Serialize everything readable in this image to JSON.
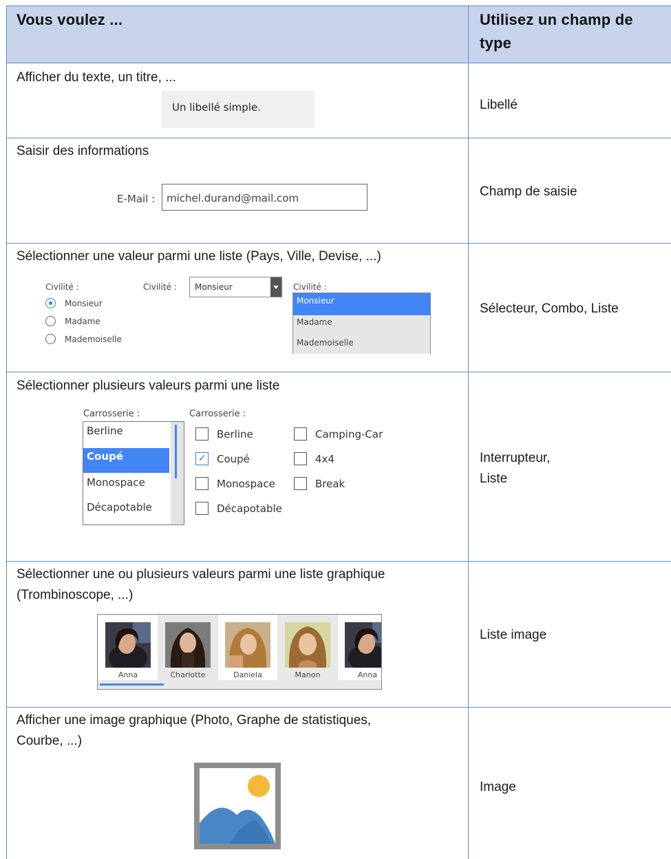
{
  "header": {
    "col1": "Vous voulez ...",
    "col2_line1": "Utilisez un champ de",
    "col2_line2": "type"
  },
  "rows": [
    {
      "description": "Afficher du texte, un titre, ...",
      "type": "Libellé",
      "example": {
        "label_text": "Un libellé simple."
      }
    },
    {
      "description": "Saisir des informations",
      "type": "Champ de saisie",
      "example": {
        "field_label": "E-Mail :",
        "field_value": "michel.durand@mail.com"
      }
    },
    {
      "description": "Sélectionner une valeur parmi une liste (Pays, Ville, Devise, ...)",
      "type": "Sélecteur, Combo, Liste",
      "example": {
        "radio_label": "Civilité :",
        "radio_options": [
          "Monsieur",
          "Madame",
          "Mademoiselle"
        ],
        "radio_selected": "Monsieur",
        "combo_label": "Civilité :",
        "combo_value": "Monsieur",
        "list_label": "Civilité :",
        "list_options": [
          "Monsieur",
          "Madame",
          "Mademoiselle"
        ],
        "list_selected": "Monsieur"
      }
    },
    {
      "description": "Sélectionner plusieurs valeurs parmi une liste",
      "type_line1": "Interrupteur,",
      "type_line2": "Liste",
      "example": {
        "list_label": "Carrosserie :",
        "list_items": [
          "Berline",
          "Coupé",
          "Monospace",
          "Décapotable"
        ],
        "list_selected": "Coupé",
        "check_label": "Carrosserie :",
        "check_col1": [
          "Berline",
          "Coupé",
          "Monospace",
          "Décapotable"
        ],
        "check_col2": [
          "Camping-Car",
          "4x4",
          "Break"
        ],
        "checked": [
          "Coupé"
        ]
      }
    },
    {
      "description_line1": "Sélectionner une ou plusieurs valeurs parmi une liste graphique",
      "description_line2": "(Trombinoscope, ...)",
      "type": "Liste image",
      "example": {
        "names": [
          "Anna",
          "Charlotte",
          "Daniela",
          "Manon",
          "Anna"
        ]
      }
    },
    {
      "description_line1": "Afficher une image graphique (Photo, Graphe de statistiques,",
      "description_line2": "Courbe, ...)",
      "type": "Image"
    }
  ],
  "colors": {
    "header_bg": "#c6d3eb",
    "border": "#5b8ed6",
    "accent": "#4285f4"
  }
}
